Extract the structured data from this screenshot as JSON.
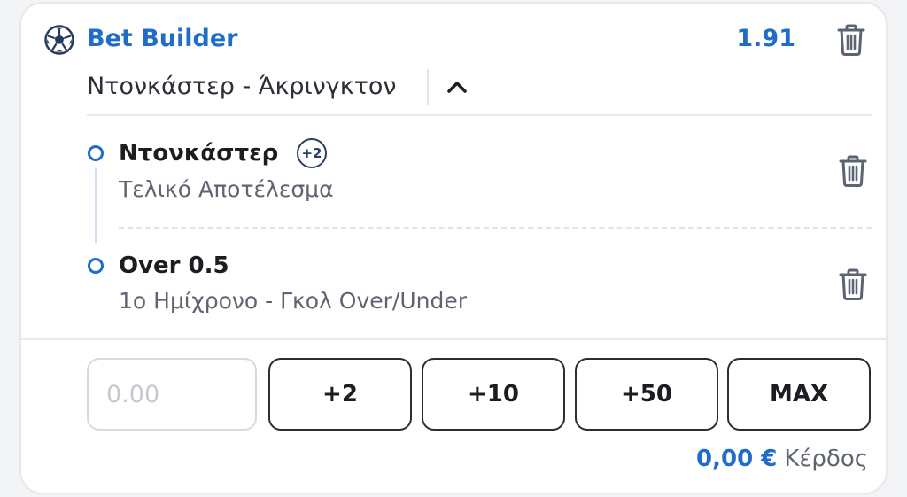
{
  "header": {
    "icon": "soccer-ball-icon",
    "title": "Bet Builder",
    "odds": "1.91"
  },
  "match": {
    "name": "Ντονκάστερ - Άκρινγκτον",
    "expanded": true
  },
  "selections": [
    {
      "name": "Ντονκάστερ",
      "badge": "+2",
      "market": "Τελικό Αποτέλεσμα"
    },
    {
      "name": "Over 0.5",
      "market": "1ο Ημίχρονο - Γκολ Over/Under"
    }
  ],
  "stake": {
    "value": "",
    "placeholder": "0.00"
  },
  "quick_stakes": [
    "+2",
    "+10",
    "+50",
    "MAX"
  ],
  "profit": {
    "value": "0,00 €",
    "label": "Κέρδος"
  },
  "colors": {
    "accent": "#1f6cc9",
    "text": "#1b1d21",
    "muted": "#5f6570",
    "border": "#e6e8ec",
    "icon": "#5b6472"
  }
}
